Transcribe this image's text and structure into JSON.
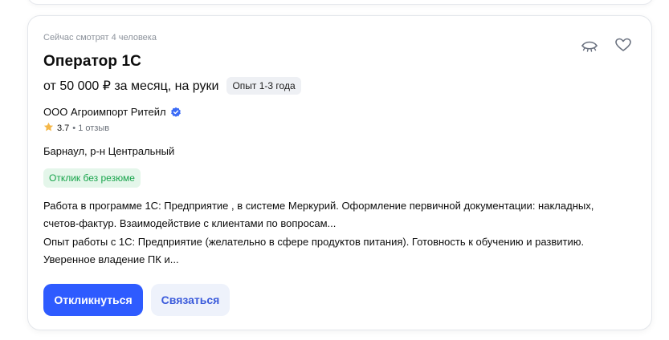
{
  "vacancy": {
    "watchers": "Сейчас смотрят 4 человека",
    "title": "Оператор 1С",
    "salary": "от 50 000 ₽ за месяц, на руки",
    "experience": "Опыт 1-3 года",
    "company": "ООО Агроимпорт Ритейл",
    "rating": "3.7",
    "reviews": "• 1 отзыв",
    "location": "Барнаул, р-н Центральный",
    "no_resume_badge": "Отклик без резюме",
    "description_1": "Работа в программе 1С: Предприятие , в системе Меркурий. Оформление первичной документации: накладных, счетов-фактур. Взаимодействие с клиентами по вопросам...",
    "description_2": "Опыт работы с 1С: Предприятие (желательно в сфере продуктов питания). Готовность к обучению и развитию. Уверенное владение ПК и..."
  },
  "actions": {
    "respond_label": "Откликнуться",
    "contact_label": "Связаться"
  },
  "icons": {
    "hide": "eye-hidden-icon",
    "favorite": "heart-icon",
    "verified": "verified-badge-icon",
    "star": "star-icon"
  },
  "colors": {
    "primary": "#2e5bff",
    "success": "#16a34a",
    "star": "#f5b748"
  }
}
